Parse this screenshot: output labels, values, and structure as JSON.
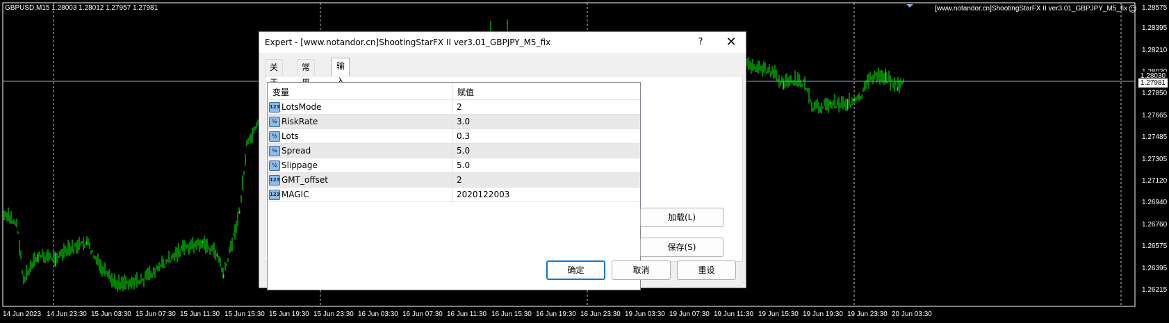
{
  "chart": {
    "symbol_info": "GBPUSD,M15  1.28003 1.28012 1.27957 1.27981",
    "ea_name": "[www.notandor.cn]ShootingStarFX II ver3.01_GBPJPY_M5_fix",
    "current_price": "1.27981",
    "bid_line_price": "1.28030",
    "price_ticks": [
      "1.28575",
      "1.28395",
      "1.28210",
      "1.28030",
      "1.27850",
      "1.27665",
      "1.27485",
      "1.27305",
      "1.27120",
      "1.26940",
      "1.26760",
      "1.26575",
      "1.26395",
      "1.26215"
    ],
    "time_ticks": [
      "14 Jun 2023",
      "14 Jun 23:30",
      "15 Jun 03:30",
      "15 Jun 07:30",
      "15 Jun 11:30",
      "15 Jun 15:30",
      "15 Jun 19:30",
      "15 Jun 23:30",
      "16 Jun 03:30",
      "16 Jun 07:30",
      "16 Jun 11:30",
      "16 Jun 15:30",
      "16 Jun 19:30",
      "16 Jun 23:30",
      "19 Jun 03:30",
      "19 Jun 07:30",
      "19 Jun 11:30",
      "19 Jun 15:30",
      "19 Jun 19:30",
      "19 Jun 23:30",
      "20 Jun 03:30"
    ],
    "colors": {
      "background": "#000000",
      "candles": "#00ff00",
      "grid": "#c8c8c8",
      "bid_line": "#8ea7d8"
    }
  },
  "dialog": {
    "title": "Expert - [www.notandor.cn]ShootingStarFX II ver3.01_GBPJPY_M5_fix",
    "help_label": "?",
    "close_label": "✕",
    "tabs": [
      {
        "label": "关于",
        "active": false
      },
      {
        "label": "常用",
        "active": false
      },
      {
        "label": "输入参数",
        "active": true
      }
    ],
    "grid_headers": {
      "variable": "变量",
      "value": "赋值"
    },
    "params": [
      {
        "icon": "123",
        "name": "LotsMode",
        "value": "2"
      },
      {
        "icon": "½",
        "name": "RiskRate",
        "value": "3.0"
      },
      {
        "icon": "½",
        "name": "Lots",
        "value": "0.3"
      },
      {
        "icon": "½",
        "name": "Spread",
        "value": "5.0"
      },
      {
        "icon": "½",
        "name": "Slippage",
        "value": "5.0"
      },
      {
        "icon": "123",
        "name": "GMT_offset",
        "value": "2"
      },
      {
        "icon": "123",
        "name": "MAGIC",
        "value": "2020122003"
      }
    ],
    "buttons": {
      "load": "加载(L)",
      "save": "保存(S)",
      "ok": "确定",
      "cancel": "取消",
      "reset": "重设"
    }
  }
}
